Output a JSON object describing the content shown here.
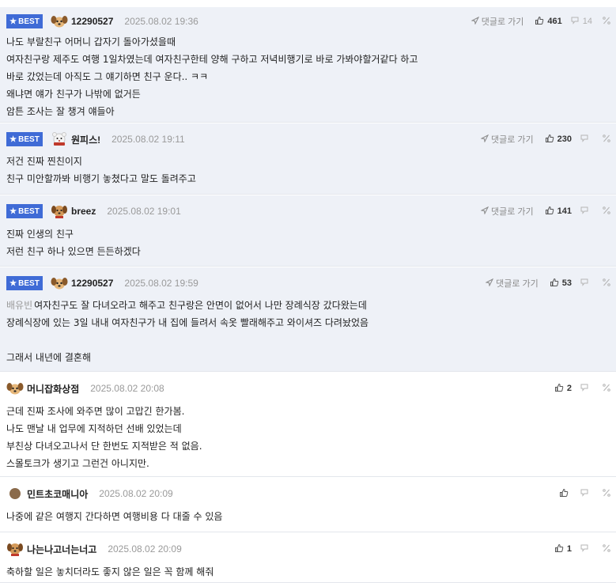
{
  "labels": {
    "best": "BEST",
    "goto": "댓글로 가기"
  },
  "comments": [
    {
      "best": true,
      "avatar": "dog-avatar",
      "nickname": "12290527",
      "date": "2025.08.02 19:36",
      "show_goto": true,
      "likes": "461",
      "dislikes": "14",
      "lines": [
        "나도 부랄친구 어머니 갑자기 돌아가셨을때",
        "여자친구랑 제주도 여행 1일차였는데 여자친구한테 양해 구하고 저녁비행기로 바로 가봐야할거같다 하고",
        "바로 갔었는데 아직도 그 얘기하면 친구 운다.. ㅋㅋ",
        "왜냐면 얘가 친구가 나밖에 없거든",
        "암튼 조사는 잘 챙겨 얘들아"
      ]
    },
    {
      "best": true,
      "avatar": "bear-avatar",
      "nickname": "원피스!",
      "date": "2025.08.02 19:11",
      "show_goto": true,
      "likes": "230",
      "dislikes": "",
      "lines": [
        "저건 진짜 찐친이지",
        "친구 미안할까봐 비행기 놓쳤다고 말도 돌려주고"
      ]
    },
    {
      "best": true,
      "avatar": "puppy-avatar",
      "nickname": "breez",
      "date": "2025.08.02 19:01",
      "show_goto": true,
      "likes": "141",
      "dislikes": "",
      "lines": [
        "진짜 인생의 친구",
        "저런 친구 하나 있으면 든든하겠다"
      ]
    },
    {
      "best": true,
      "avatar": "dog-avatar",
      "nickname": "12290527",
      "date": "2025.08.02 19:59",
      "show_goto": true,
      "likes": "53",
      "dislikes": "",
      "mention": "배유빈",
      "lines": [
        "여자친구도 잘 다녀오라고 해주고 친구랑은 안면이 없어서 나만 장례식장 갔다왔는데",
        "장례식장에 있는 3일 내내 여자친구가 내 집에 들려서 속옷 빨래해주고 와이셔즈 다려놨었음",
        "",
        "그래서 내년에 결혼해"
      ]
    },
    {
      "best": false,
      "avatar": "dog-avatar",
      "nickname": "머니잡화상점",
      "date": "2025.08.02 20:08",
      "show_goto": false,
      "likes": "2",
      "dislikes": "",
      "lines": [
        "근데 진짜 조사에 와주면 많이 고맙긴 한가봄.",
        "나도 맨날 내 업무에 지적하던 선배 있었는데",
        "부친상 다녀오고나서 단 한번도 지적받은 적 없음.",
        "스몰토크가 생기고 그런건 아니지만."
      ]
    },
    {
      "best": false,
      "avatar": "circle-avatar",
      "nickname": "민트초코매니아",
      "date": "2025.08.02 20:09",
      "show_goto": false,
      "likes": "",
      "dislikes": "",
      "lines": [
        "나중에 같은 여행지 간다하면 여행비용 다 대줄 수 있음"
      ]
    },
    {
      "best": false,
      "avatar": "puppy-avatar",
      "nickname": "나는나고너는너고",
      "date": "2025.08.02 20:09",
      "show_goto": false,
      "likes": "1",
      "dislikes": "",
      "lines": [
        "축하할 일은 놓치더라도 좋지 않은 일은 꼭 함께 해줘"
      ]
    }
  ],
  "colors": {
    "best_badge": "#3f6bd6",
    "best_bg": "#eef1f7",
    "mention": "#9a9a9a"
  }
}
